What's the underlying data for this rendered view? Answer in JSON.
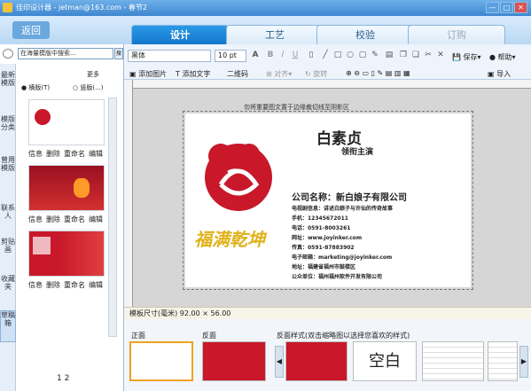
{
  "window": {
    "title": "佳印设计器 - jetman@163.com - 春节2",
    "controls": [
      "—",
      "□",
      "✕"
    ]
  },
  "nav": {
    "back": "返回",
    "tabs": [
      "设计",
      "工艺",
      "校验",
      "订购"
    ],
    "active": 0
  },
  "sidebar": {
    "search_placeholder": "在海量模版中搜索...",
    "search_btn": "搜",
    "vtabs": [
      "最新模版",
      "模版分类",
      "曾用模版",
      "联系人",
      "剪贴画",
      "收藏夹",
      "草稿箱"
    ],
    "more": "更多",
    "orient_h": "横版(T)",
    "orient_v": "竖版(...)",
    "actions": [
      "信息",
      "删除",
      "重命名",
      "编辑"
    ],
    "pages": "1 2"
  },
  "toolbar": {
    "font": "黑体",
    "size": "10 pt",
    "add_image": "添加图片",
    "add_text": "添加文字",
    "qrcode": "二维码",
    "align": "对齐",
    "rotate": "旋转",
    "save": "保存",
    "help": "帮助",
    "import": "导入"
  },
  "canvas": {
    "hint": "勿将重要图文置于边缘裁切线至阴影区",
    "name": "白素贞",
    "title": "领衔主演",
    "company": "公司名称：新白娘子有限公司",
    "lines": [
      "电视剧信息：讲述白娘子与许仙的传奇故事",
      "手机：12345672011",
      "电话：0591-8003261",
      "网址：www.joyinker.com",
      "传真：0591-87883902",
      "电子邮箱：marketing@joyinker.com",
      "地址：福建省福州市鼓楼区",
      "公众单位：福州福州软件开发有限公司"
    ],
    "slogan": "福满乾坤"
  },
  "status": {
    "size": "模板尺寸(毫米)",
    "value": "92.00 × 56.00"
  },
  "bottom": {
    "front": "正面",
    "back": "反面",
    "style": "反面样式(双击缩略图以选择您喜欢的样式)",
    "blank": "空白"
  },
  "colors": {
    "accent": "#1a84d8",
    "red": "#c8182a",
    "gold": "#e0b21a"
  }
}
